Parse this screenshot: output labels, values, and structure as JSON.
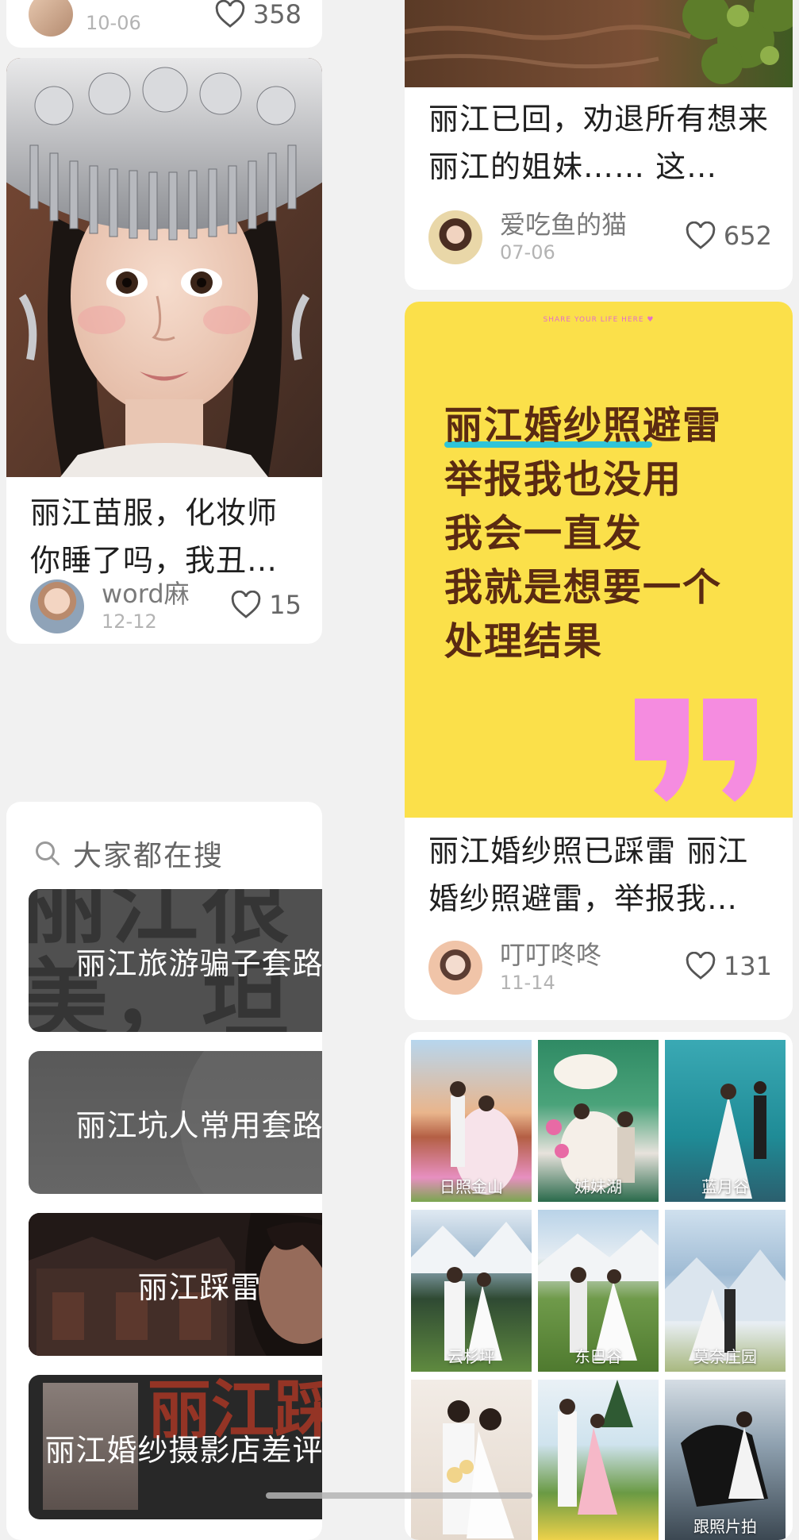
{
  "feed": {
    "top_left_card": {
      "date": "10-06",
      "likes": "358"
    },
    "miao_card": {
      "title": "丽江苗服，化妆师你睡了吗，我丑得睡不着 …",
      "author": "word麻",
      "date": "12-12",
      "likes": "15"
    },
    "lijiang_back_card": {
      "title": "丽江已回，劝退所有想来丽江的姐妹…… 这…",
      "author": "爱吃鱼的猫",
      "date": "07-06",
      "likes": "652"
    },
    "wedding_warning_card": {
      "poster_small_text": "SHARE YOUR LIFE HERE ♥",
      "poster_lines": [
        "丽江婚纱照避雷",
        "举报我也没用",
        "我会一直发",
        "我就是想要一个",
        "处理结果"
      ],
      "title": "丽江婚纱照已踩雷 丽江婚纱照避雷，举报我…",
      "author": "叮叮咚咚",
      "date": "11-14",
      "likes": "131"
    },
    "search_section": {
      "header": "大家都在搜",
      "items": [
        {
          "label": "丽江旅游骗子套路",
          "bg_text": "丽江很美，坦套路"
        },
        {
          "label": "丽江坑人常用套路"
        },
        {
          "label": "丽江踩雷"
        },
        {
          "label": "丽江婚纱摄影店差评…",
          "bg_text": "丽江踩坑"
        }
      ]
    },
    "wedding_grid": {
      "captions": [
        "日照金山",
        "姊妹湖",
        "蓝月谷",
        "云杉坪",
        "东巴谷",
        "莫奈庄园",
        "",
        "",
        "跟照片拍"
      ]
    }
  },
  "colors": {
    "poster_yellow": "#fbe04a",
    "poster_text": "#5a2a12",
    "poster_quote": "#f58ce0",
    "poster_underline": "#2fc4d8"
  }
}
